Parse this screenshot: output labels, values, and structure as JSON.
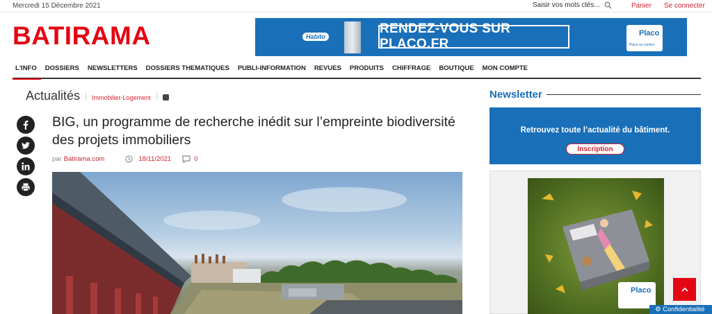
{
  "topbar": {
    "date": "Mercredi 15 Décembre 2021",
    "search_placeholder": "Saisir vos mots clés...",
    "cart": "Panier",
    "login": "Se connecter"
  },
  "brand": {
    "logo": "BATIRAMA",
    "color": "#e30613"
  },
  "banner": {
    "habito": "Habito",
    "cta": "RENDEZ-VOUS SUR PLACO.FR",
    "placo_brand": "Placo",
    "placo_tagline": "Place au confort",
    "bg_color": "#1a6fb9"
  },
  "nav": {
    "items": [
      {
        "label": "L'INFO"
      },
      {
        "label": "DOSSIERS"
      },
      {
        "label": "NEWSLETTERS"
      },
      {
        "label": "DOSSIERS THEMATIQUES"
      },
      {
        "label": "PUBLI-INFORMATION"
      },
      {
        "label": "REVUES"
      },
      {
        "label": "PRODUITS"
      },
      {
        "label": "CHIFFRAGE"
      },
      {
        "label": "BOUTIQUE"
      },
      {
        "label": "MON COMPTE"
      }
    ]
  },
  "section": {
    "title": "Actualités",
    "category": "Immobilier-Logement"
  },
  "social": {
    "facebook": "facebook-icon",
    "twitter": "twitter-icon",
    "linkedin": "linkedin-icon",
    "print": "print-icon"
  },
  "article": {
    "title": "BIG, un programme de recherche inédit sur l’empreinte biodiversité des projets immobiliers",
    "by_prefix": "par",
    "author": "Batirama.com",
    "date": "18/11/2021",
    "comments": "0"
  },
  "sidebar": {
    "newsletter_title": "Newsletter",
    "newsletter_text": "Retrouvez toute l’actualité du bâtiment.",
    "newsletter_button": "Inscription",
    "ad_brand": "Placo"
  },
  "floating": {
    "privacy": "Confidentialité"
  }
}
